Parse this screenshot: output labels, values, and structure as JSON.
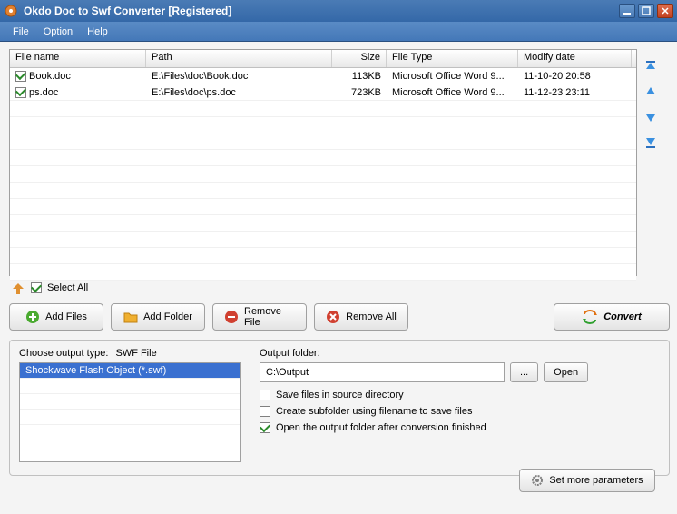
{
  "window": {
    "title": "Okdo Doc to Swf Converter [Registered]"
  },
  "menu": {
    "file": "File",
    "option": "Option",
    "help": "Help"
  },
  "columns": {
    "name": "File name",
    "path": "Path",
    "size": "Size",
    "type": "File Type",
    "date": "Modify date"
  },
  "files": [
    {
      "checked": true,
      "name": "Book.doc",
      "path": "E:\\Files\\doc\\Book.doc",
      "size": "113KB",
      "type": "Microsoft Office Word 9...",
      "date": "11-10-20 20:58"
    },
    {
      "checked": true,
      "name": "ps.doc",
      "path": "E:\\Files\\doc\\ps.doc",
      "size": "723KB",
      "type": "Microsoft Office Word 9...",
      "date": "11-12-23 23:11"
    }
  ],
  "selectAll": {
    "label": "Select All",
    "checked": true
  },
  "buttons": {
    "addFiles": "Add Files",
    "addFolder": "Add Folder",
    "removeFile": "Remove File",
    "removeAll": "Remove All",
    "convert": "Convert",
    "browse": "...",
    "open": "Open",
    "moreParams": "Set more parameters"
  },
  "output": {
    "chooseTypeLabel": "Choose output type:",
    "typeName": "SWF File",
    "typeItem": "Shockwave Flash Object (*.swf)",
    "folderLabel": "Output folder:",
    "folderPath": "C:\\Output",
    "saveInSource": {
      "label": "Save files in source directory",
      "checked": false
    },
    "createSubfolder": {
      "label": "Create subfolder using filename to save files",
      "checked": false
    },
    "openAfter": {
      "label": "Open the output folder after conversion finished",
      "checked": true
    }
  }
}
